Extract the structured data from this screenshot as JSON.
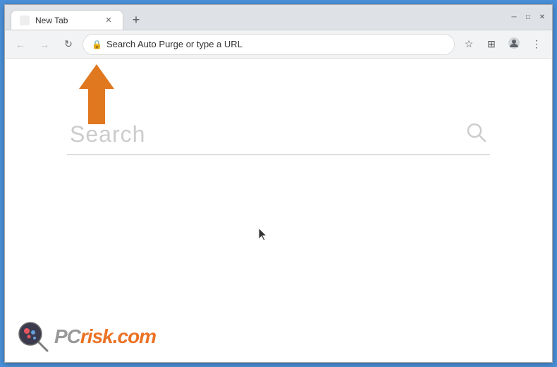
{
  "browser": {
    "tab": {
      "title": "New Tab",
      "favicon_label": "tab-favicon"
    },
    "new_tab_btn": "+",
    "window_controls": {
      "minimize": "─",
      "maximize": "□",
      "close": "✕"
    },
    "nav": {
      "back": "←",
      "forward": "→",
      "refresh": "↻"
    },
    "address_bar": {
      "placeholder": "Search Auto Purge or type a URL",
      "icon": "🔍"
    },
    "toolbar_icons": {
      "star": "☆",
      "extensions": "⊞",
      "profile": "👤",
      "menu": "⋮"
    }
  },
  "page": {
    "search_placeholder": "Search",
    "cursor_visible": true
  },
  "watermark": {
    "logo_alt": "PCrisk logo",
    "pc_text": "PC",
    "risk_text": "risk.com"
  },
  "arrow": {
    "label": "annotation arrow pointing to address bar"
  }
}
